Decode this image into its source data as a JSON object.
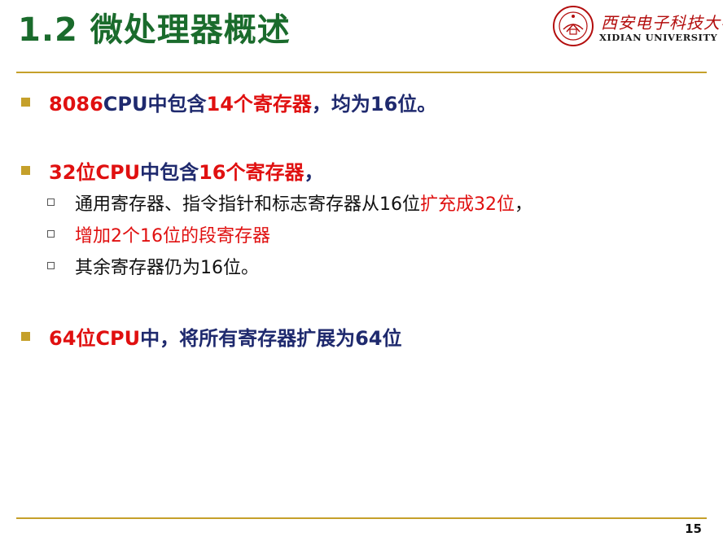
{
  "slide": {
    "title": "1.2 微处理器概述",
    "page_number": "15"
  },
  "logo": {
    "cn_name": "西安电子科技大学",
    "en_name": "XIDIAN UNIVERSITY",
    "seal_text": "XIDIAN UNIVERSITY"
  },
  "bullets": [
    {
      "parts": [
        {
          "text": "8086",
          "color": "red"
        },
        {
          "text": "CPU中包含",
          "color": "navy"
        },
        {
          "text": "14个寄存器",
          "color": "red"
        },
        {
          "text": "，均为16位。",
          "color": "navy"
        }
      ]
    },
    {
      "parts": [
        {
          "text": "32位CPU",
          "color": "red"
        },
        {
          "text": "中包含",
          "color": "navy"
        },
        {
          "text": "16个寄存器",
          "color": "red"
        },
        {
          "text": "，",
          "color": "navy"
        }
      ],
      "sub": [
        {
          "parts": [
            {
              "text": "通用寄存器、指令指针和标志寄存器从16位",
              "color": "black"
            },
            {
              "text": "扩充成32位",
              "color": "red"
            },
            {
              "text": "，",
              "color": "black"
            }
          ]
        },
        {
          "parts": [
            {
              "text": "增加2个16位的段寄存器",
              "color": "red"
            }
          ]
        },
        {
          "parts": [
            {
              "text": "其余寄存器仍为16位。",
              "color": "black"
            }
          ]
        }
      ]
    },
    {
      "parts": [
        {
          "text": "64位CPU",
          "color": "red"
        },
        {
          "text": "中，将所有寄存器扩展为64位",
          "color": "navy"
        }
      ]
    }
  ],
  "colors": {
    "title": "#1a6b2c",
    "navy": "#1f2a6e",
    "red": "#e01010",
    "rule": "#c5a02a",
    "bullet": "#c5a02a",
    "logo_red": "#b30d0d"
  }
}
